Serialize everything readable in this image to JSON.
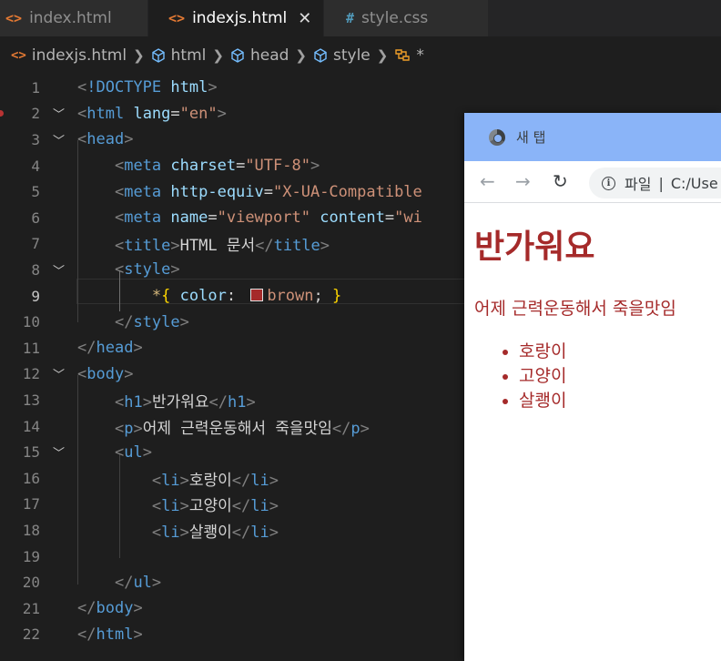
{
  "tabs": [
    {
      "label": "index.html",
      "icon": "html-file-icon",
      "active": false
    },
    {
      "label": "indexjs.html",
      "icon": "html-file-icon",
      "active": true
    },
    {
      "label": "style.css",
      "icon": "css-file-icon",
      "active": false
    }
  ],
  "breadcrumb": {
    "file": "indexjs.html",
    "items": [
      "html",
      "head",
      "style",
      "*"
    ]
  },
  "editor": {
    "line_numbers": [
      "1",
      "2",
      "3",
      "4",
      "5",
      "6",
      "7",
      "8",
      "9",
      "10",
      "11",
      "12",
      "13",
      "14",
      "15",
      "16",
      "17",
      "18",
      "19",
      "20",
      "21",
      "22"
    ],
    "current_line": "9",
    "title_text": "HTML 문서",
    "selector": "*",
    "color_value": "brown",
    "h1_text": "반가워요",
    "p_text": "어제 근력운동해서 죽을맛임",
    "li_items": [
      "호랑이",
      "고양이",
      "살쾡이"
    ],
    "meta_charset": "\"UTF-8\"",
    "meta_equiv": "\"X-UA-Compatible",
    "meta_name": "\"viewport\"",
    "meta_content_partial": "\"wi",
    "lang_value": "\"en\""
  },
  "browser": {
    "tab_title": "새 탭",
    "address_scheme": "파일",
    "address_path": "C:/Use",
    "page": {
      "heading": "반가워요",
      "paragraph": "어제 근력운동해서 죽을맛임",
      "list": [
        "호랑이",
        "고양이",
        "살쾡이"
      ]
    }
  },
  "colors": {
    "editor_bg": "#1e1e1e",
    "tag": "#569cd6",
    "attribute": "#9cdcfe",
    "string": "#ce9178",
    "page_text": "#a52a2a",
    "browser_titlebar": "#8ab4f8"
  }
}
